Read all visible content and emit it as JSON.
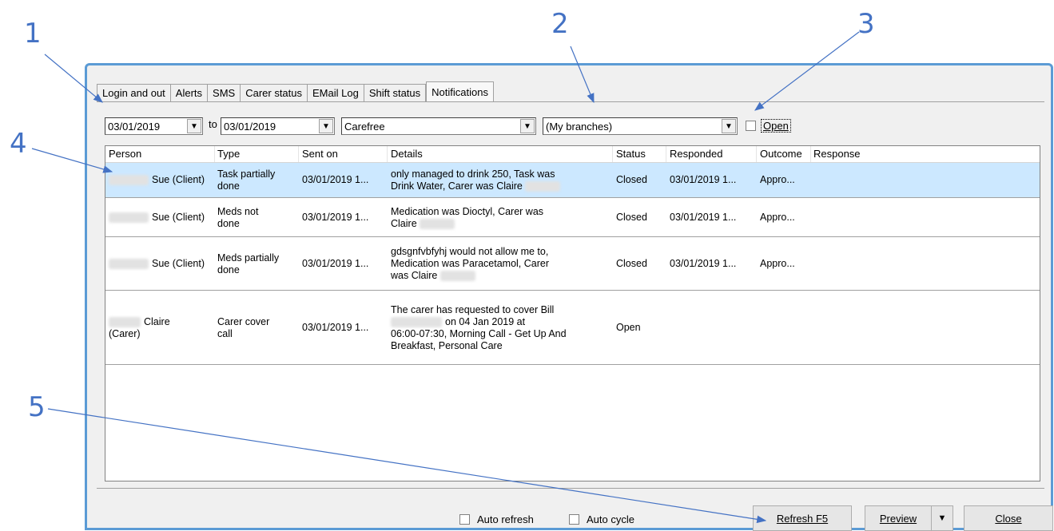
{
  "callouts": [
    "1",
    "2",
    "3",
    "4",
    "5"
  ],
  "tabs": [
    "Login and out",
    "Alerts",
    "SMS",
    "Carer status",
    "EMail Log",
    "Shift status",
    "Notifications"
  ],
  "filters": {
    "date_from": "03/01/2019",
    "to_label": "to",
    "date_to": "03/01/2019",
    "company": "Carefree",
    "branch": "(My branches)",
    "open_label": "Open",
    "open_checked": false
  },
  "grid": {
    "headers": [
      "Person",
      "Type",
      "Sent on",
      "Details",
      "Status",
      "Responded",
      "Outcome",
      "Response"
    ],
    "rows": [
      {
        "person": "Sue (Client)",
        "type": [
          "Task partially",
          "done"
        ],
        "sent": "03/01/2019 1...",
        "details": [
          "only managed to drink 250, Task was",
          "Drink Water, Carer was Claire"
        ],
        "status": "Closed",
        "responded": "03/01/2019 1...",
        "outcome": "Appro...",
        "response": ""
      },
      {
        "person": "Sue (Client)",
        "type": [
          "Meds not",
          "done"
        ],
        "sent": "03/01/2019 1...",
        "details": [
          "Medication was Dioctyl, Carer was",
          "Claire"
        ],
        "status": "Closed",
        "responded": "03/01/2019 1...",
        "outcome": "Appro...",
        "response": ""
      },
      {
        "person": "Sue (Client)",
        "type": [
          "Meds partially",
          "done"
        ],
        "sent": "03/01/2019 1...",
        "details": [
          "gdsgnfvbfyhj  would not allow me to,",
          "Medication was Paracetamol, Carer",
          "was Claire"
        ],
        "status": "Closed",
        "responded": "03/01/2019 1...",
        "outcome": "Appro...",
        "response": ""
      },
      {
        "person_line1": "Claire",
        "person_line2": "(Carer)",
        "type": [
          "Carer cover",
          "call"
        ],
        "sent": "03/01/2019 1...",
        "details": [
          "The carer has requested to cover Bill",
          "on 04 Jan 2019 at",
          "06:00-07:30, Morning Call - Get Up And",
          "Breakfast, Personal Care"
        ],
        "status": "Open",
        "responded": "",
        "outcome": "",
        "response": ""
      }
    ]
  },
  "footer": {
    "auto_refresh": "Auto refresh",
    "auto_cycle": "Auto cycle",
    "refresh": "Refresh F5",
    "preview": "Preview",
    "close": "Close"
  },
  "colors": {
    "callout": "#4472c4",
    "window_border": "#5b9bd5",
    "selected_row": "#cce8ff"
  }
}
